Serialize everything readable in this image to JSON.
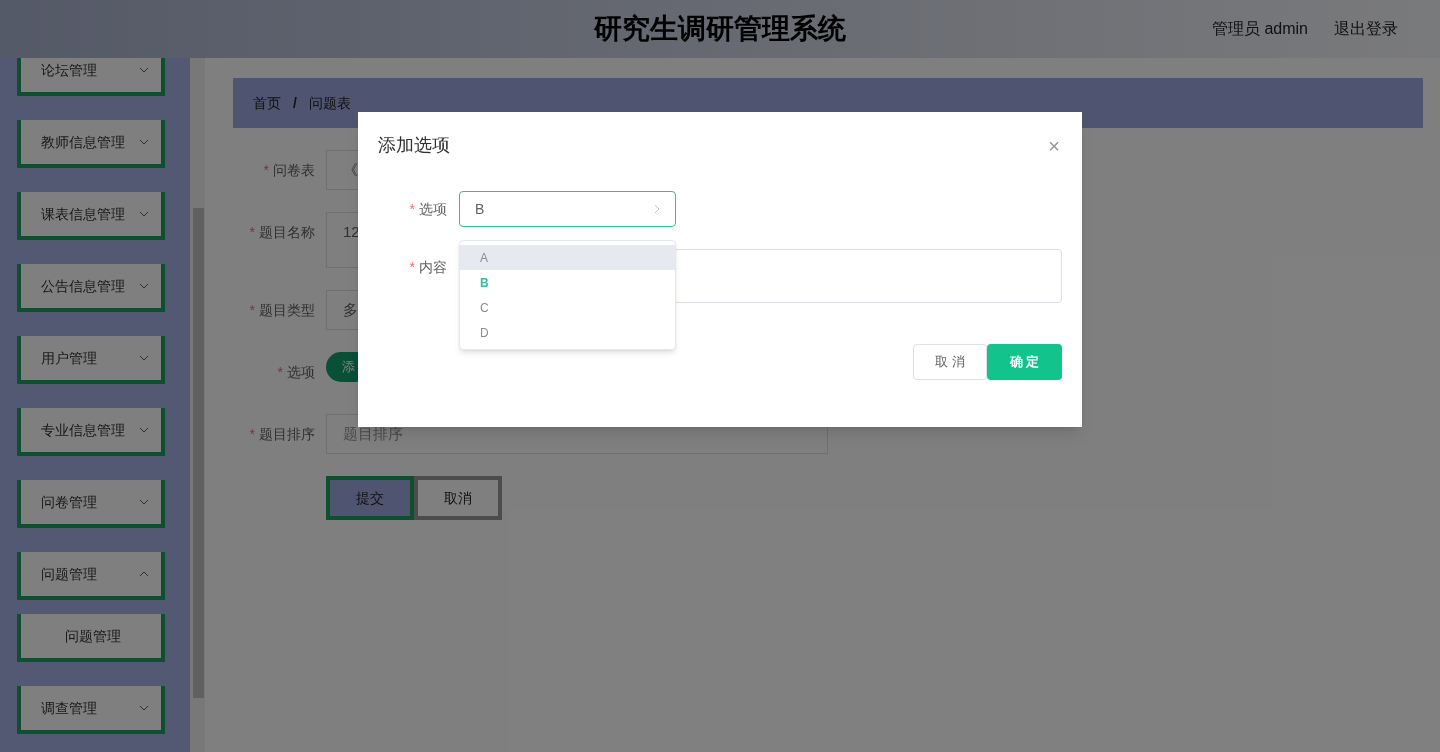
{
  "required_mark": "*",
  "header": {
    "title": "研究生调研管理系统",
    "user": "管理员 admin",
    "logout": "退出登录"
  },
  "sidebar": {
    "items": [
      {
        "label": "论坛管理",
        "expanded": false
      },
      {
        "label": "教师信息管理",
        "expanded": false
      },
      {
        "label": "课表信息管理",
        "expanded": false
      },
      {
        "label": "公告信息管理",
        "expanded": false
      },
      {
        "label": "用户管理",
        "expanded": false
      },
      {
        "label": "专业信息管理",
        "expanded": false
      },
      {
        "label": "问卷管理",
        "expanded": false
      },
      {
        "label": "问题管理",
        "expanded": true,
        "children": [
          {
            "label": "问题管理"
          }
        ]
      },
      {
        "label": "调查管理",
        "expanded": false
      }
    ]
  },
  "breadcrumb": {
    "items": [
      "首页",
      "问题表"
    ],
    "separator": "/"
  },
  "form": {
    "fields": [
      {
        "label": "问卷表",
        "kind": "select",
        "required": true,
        "value": "《"
      },
      {
        "label": "题目名称",
        "kind": "textarea",
        "required": true,
        "value": "12"
      },
      {
        "label": "题目类型",
        "kind": "select",
        "required": true,
        "value": "多"
      },
      {
        "label": "选项",
        "kind": "button",
        "required": true,
        "button": "添"
      },
      {
        "label": "题目排序",
        "kind": "input",
        "required": true,
        "placeholder": "题目排序"
      }
    ],
    "buttons": [
      {
        "label": "提交",
        "kind": "primary"
      },
      {
        "label": "取消",
        "kind": "default"
      }
    ]
  },
  "dialog": {
    "title": "添加选项",
    "close": "×",
    "option_field": {
      "label": "选项",
      "required": true,
      "value": "B",
      "options": [
        {
          "label": "A",
          "selected": false,
          "hovered": true
        },
        {
          "label": "B",
          "selected": true,
          "hovered": false
        },
        {
          "label": "C",
          "selected": false,
          "hovered": false
        },
        {
          "label": "D",
          "selected": false,
          "hovered": false
        }
      ]
    },
    "content_field": {
      "label": "内容",
      "required": true
    },
    "buttons": [
      {
        "label": "取 消",
        "kind": "default"
      },
      {
        "label": "确 定",
        "kind": "primary"
      }
    ]
  }
}
